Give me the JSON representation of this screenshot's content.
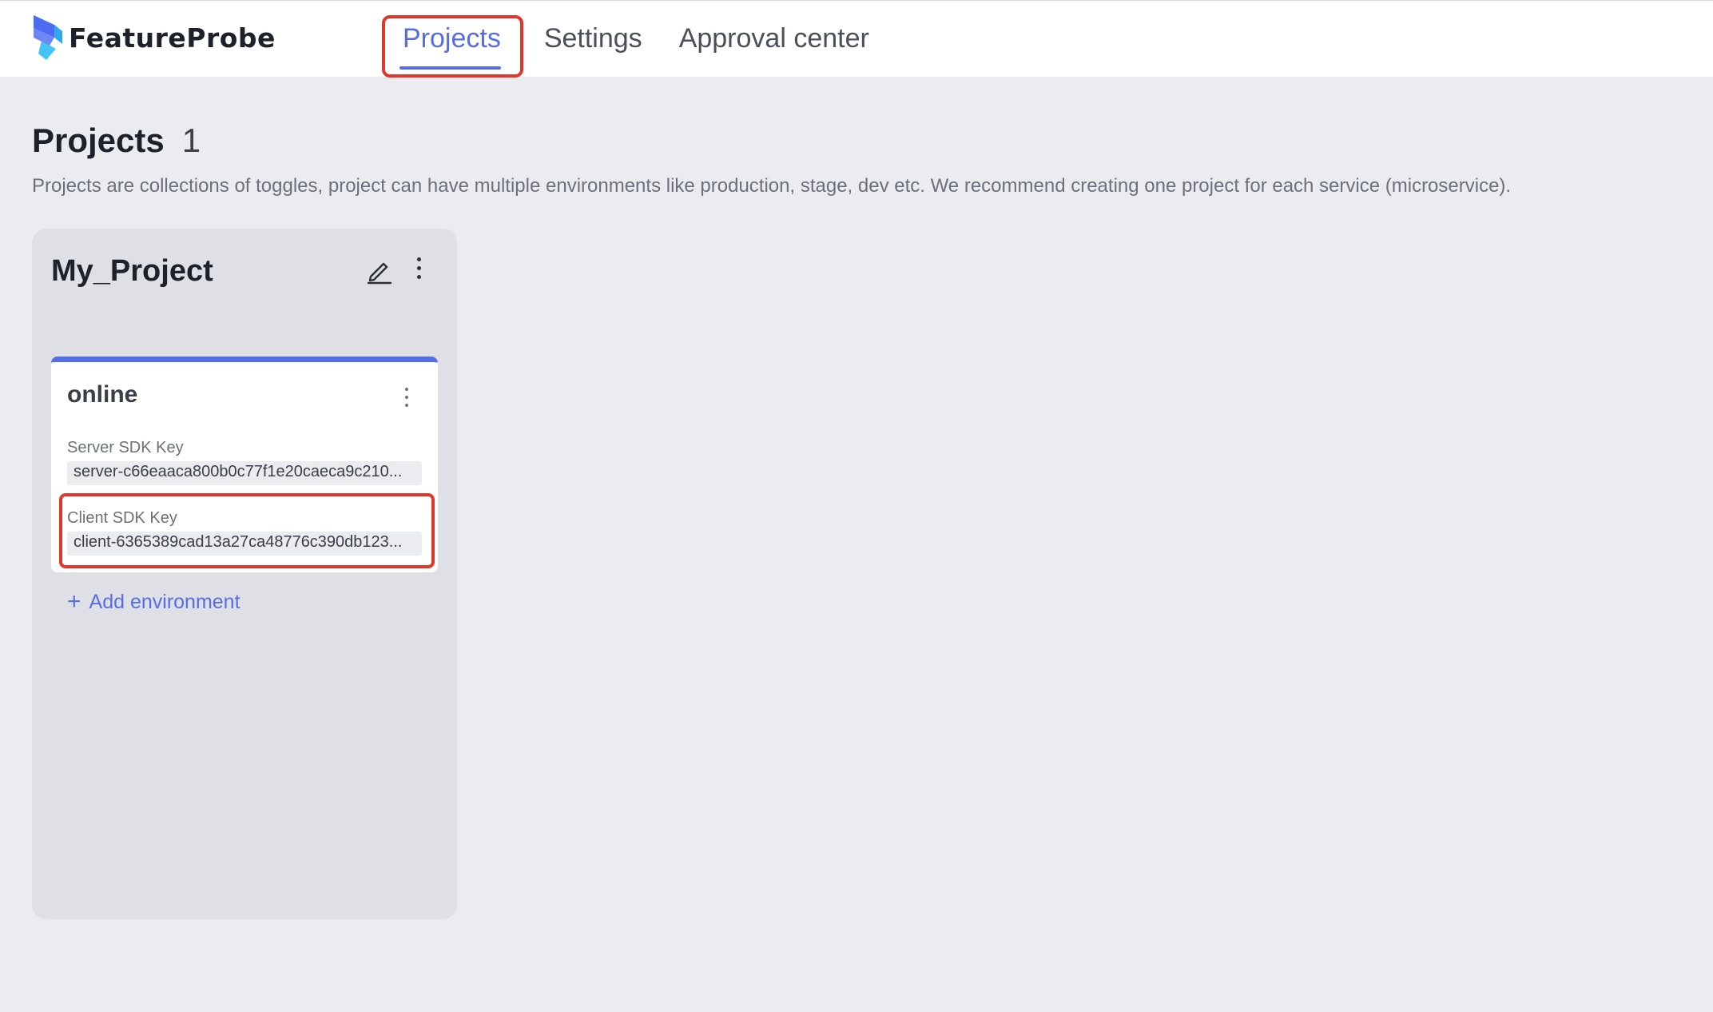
{
  "app": {
    "brand": "FeatureProbe",
    "accent_color": "#556ee6",
    "highlight_color": "#e0372a"
  },
  "nav": {
    "items": [
      {
        "label": "Projects",
        "active": true
      },
      {
        "label": "Settings",
        "active": false
      },
      {
        "label": "Approval center",
        "active": false
      }
    ]
  },
  "page": {
    "title": "Projects",
    "count": "1",
    "description": "Projects are collections of toggles, project can have multiple environments like production, stage, dev etc. We recommend creating one project for each service (microservice)."
  },
  "project": {
    "name": "My_Project",
    "edit_icon": "edit-icon",
    "more_icon": "more-vertical-icon",
    "environments": [
      {
        "name": "online",
        "server_key_label": "Server SDK Key",
        "server_key": "server-c66eaaca800b0c77f1e20caeca9c210...",
        "client_key_label": "Client SDK Key",
        "client_key": "client-6365389cad13a27ca48776c390db123..."
      }
    ],
    "add_environment_label": "Add environment"
  }
}
